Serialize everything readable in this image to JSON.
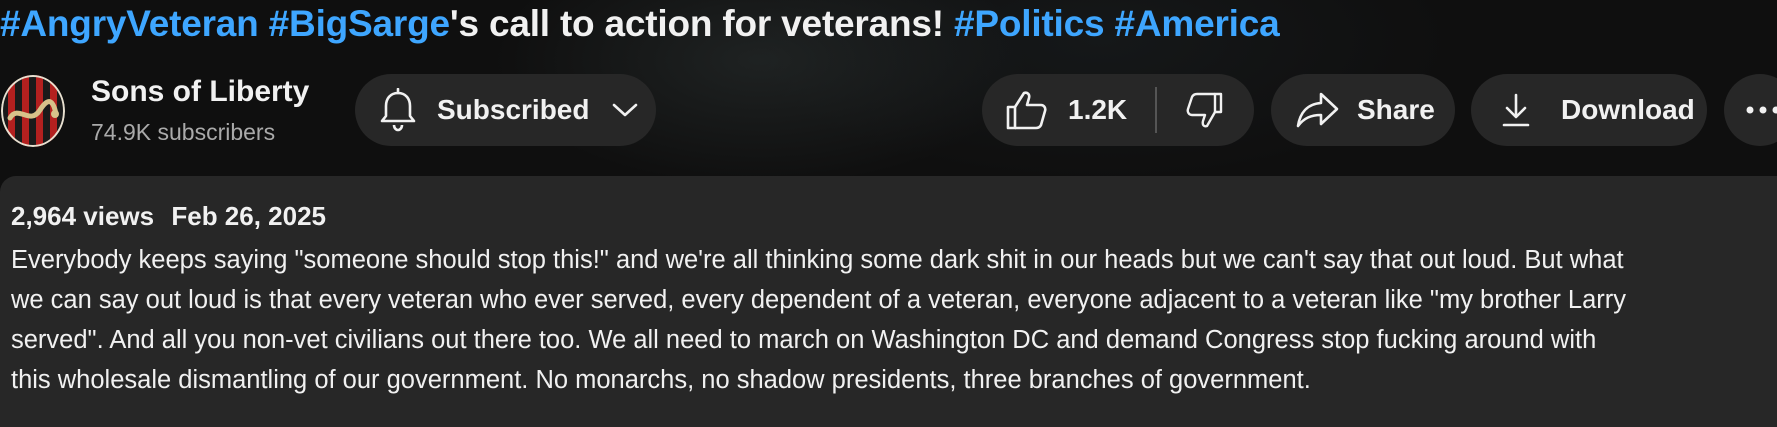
{
  "video": {
    "title_parts": [
      {
        "text": "#AngryVeteran",
        "type": "hashtag"
      },
      {
        "text": " ",
        "type": "plain"
      },
      {
        "text": "#BigSarge",
        "type": "hashtag"
      },
      {
        "text": "'s call to action for veterans! ",
        "type": "plain"
      },
      {
        "text": "#Politics",
        "type": "hashtag"
      },
      {
        "text": " ",
        "type": "plain"
      },
      {
        "text": "#America",
        "type": "hashtag"
      }
    ]
  },
  "channel": {
    "name": "Sons of Liberty",
    "subscribers": "74.9K subscribers",
    "avatar_icon": "sons-of-liberty-snake-flag-logo"
  },
  "actions": {
    "subscribed_label": "Subscribed",
    "like_count": "1.2K",
    "share_label": "Share",
    "download_label": "Download"
  },
  "description": {
    "views": "2,964 views",
    "date": "Feb 26, 2025",
    "lines": [
      "Everybody keeps saying \"someone should stop this!\" and we're all thinking some dark shit in our heads but we can't say that out loud. But what",
      "we can say out loud is that every veteran who ever served, every dependent of a veteran, everyone adjacent to a veteran like \"my brother Larry",
      "served\". And all you non-vet civilians out there too. We all need to march on Washington DC and demand Congress stop fucking around with",
      "this wholesale dismantling of our government. No monarchs, no shadow presidents, three branches of government."
    ]
  },
  "colors": {
    "background": "#0f0f0f",
    "pill": "#272727",
    "hashtag": "#3ea6ff",
    "secondary_text": "#aaaaaa"
  }
}
